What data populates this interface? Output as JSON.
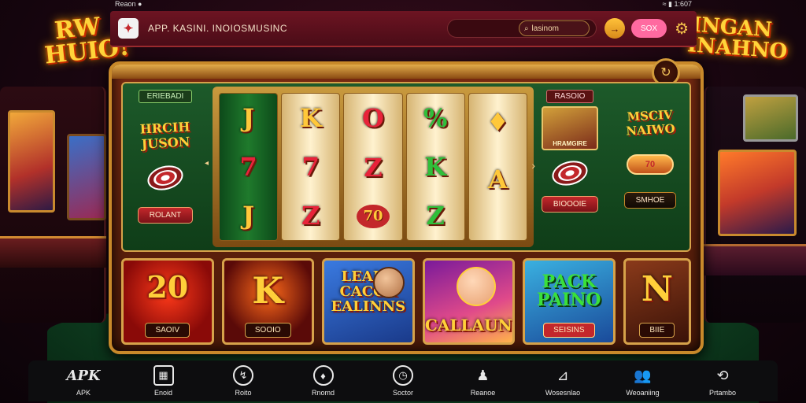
{
  "status_bar": {
    "left": "Reaon ●",
    "right": "≈ ▮ 1:607"
  },
  "background": {
    "left_sign": "RW HUIO!",
    "right_sign": "INGAN INAHNO"
  },
  "header": {
    "app_title": "APP. KASINI. INOIOSMUSINC",
    "search_placeholder": "lasnom",
    "search_value": "lasinom",
    "gold_btn_icon": "→",
    "btn1": "SOX",
    "settings_icon": "⚙"
  },
  "machine": {
    "corner_icon": "↻",
    "left_panel": {
      "tag": "ERIEBADI",
      "promo": "HRCIH JUSON",
      "button": "ROLANT"
    },
    "right_panel": {
      "tag": "RASOIO",
      "art_caption": "HRAMGIRE",
      "promo": "MSCIV NAIWO",
      "coin": "70",
      "button1": "BIOOOIE",
      "button2": "SMHOE"
    },
    "reels": [
      {
        "symbols": [
          "J",
          "7",
          "J"
        ]
      },
      {
        "symbols": [
          "K",
          "7",
          "Z"
        ]
      },
      {
        "symbols": [
          "O",
          "Z",
          "70"
        ]
      },
      {
        "symbols": [
          "%",
          "K",
          "Z"
        ]
      },
      {
        "symbols": [
          "♦",
          "A",
          ""
        ]
      }
    ]
  },
  "tiles": [
    {
      "art": "20",
      "label": "SAOIV"
    },
    {
      "art": "K",
      "label": "SOOIO"
    },
    {
      "art": "LEALO CACCK EALINNS",
      "label": ""
    },
    {
      "art": "CALLAUN",
      "label": ""
    },
    {
      "art": "PACK PAINO",
      "label": "SEISINS"
    },
    {
      "art": "N",
      "label": "BIIE"
    }
  ],
  "nav": [
    {
      "icon": "APK",
      "label": "APK"
    },
    {
      "icon": "▦",
      "label": "Enoid"
    },
    {
      "icon": "↯",
      "label": "Roito"
    },
    {
      "icon": "♦",
      "label": "Rnomd"
    },
    {
      "icon": "◷",
      "label": "Soctor"
    },
    {
      "icon": "♟",
      "label": "Reanoe"
    },
    {
      "icon": "⊿",
      "label": "Wosesnlao"
    },
    {
      "icon": "👥",
      "label": "Weoaniing"
    },
    {
      "icon": "⟲",
      "label": "Prtambo"
    }
  ],
  "colors": {
    "accent_gold": "#d6a24a",
    "brand_red": "#c3272b",
    "felt_green": "#1d5a2a"
  }
}
